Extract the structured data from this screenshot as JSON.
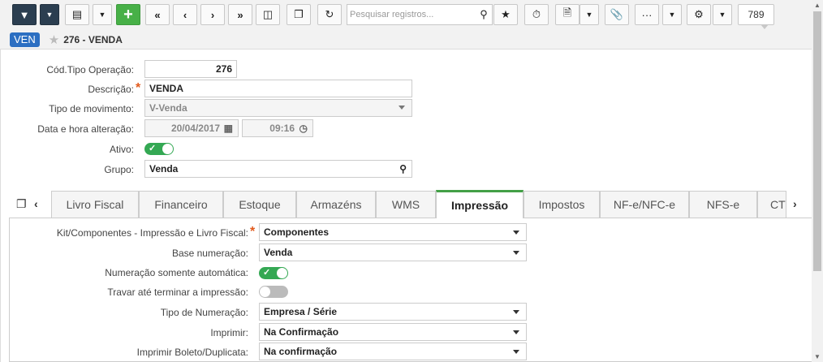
{
  "toolbar": {
    "search_placeholder": "Pesquisar registros...",
    "record_count": "789",
    "icons": [
      "filter-icon",
      "dropdown-icon",
      "grid-icon",
      "dropdown-icon",
      "add-icon",
      "first-icon",
      "prev-icon",
      "next-icon",
      "last-icon",
      "delete-icon",
      "copy-icon",
      "refresh-icon",
      "search-icon",
      "star-icon",
      "timer-icon",
      "export-icon",
      "dropdown-icon",
      "attach-icon",
      "more-icon",
      "dropdown-icon",
      "gear-icon",
      "dropdown-icon"
    ]
  },
  "header": {
    "badge": "VEN",
    "record_title": "276 - VENDA",
    "badge_color": "#2c6fc2"
  },
  "form": {
    "cod_label": "Cód.Tipo Operação:",
    "cod_value": "276",
    "desc_label": "Descrição:",
    "desc_value": "VENDA",
    "tipo_mov_label": "Tipo de movimento:",
    "tipo_mov_value": "V-Venda",
    "data_label": "Data e hora alteração:",
    "data_value": "20/04/2017",
    "hora_value": "09:16",
    "ativo_label": "Ativo:",
    "ativo": true,
    "grupo_label": "Grupo:",
    "grupo_value": "Venda"
  },
  "tabs": [
    {
      "label": "Livro Fiscal"
    },
    {
      "label": "Financeiro"
    },
    {
      "label": "Estoque"
    },
    {
      "label": "Armazéns"
    },
    {
      "label": "WMS"
    },
    {
      "label": "Impressão"
    },
    {
      "label": "Impostos"
    },
    {
      "label": "NF-e/NFC-e"
    },
    {
      "label": "NFS-e"
    },
    {
      "label": "CT"
    }
  ],
  "active_tab": "Impressão",
  "impressao": {
    "kit_label": "Kit/Componentes - Impressão e Livro Fiscal:",
    "kit_value": "Componentes",
    "base_label": "Base numeração:",
    "base_value": "Venda",
    "num_auto_label": "Numeração somente automática:",
    "num_auto": true,
    "travar_label": "Travar até terminar a impressão:",
    "travar": false,
    "tipo_num_label": "Tipo de Numeração:",
    "tipo_num_value": "Empresa / Série",
    "imprimir_label": "Imprimir:",
    "imprimir_value": "Na Confirmação",
    "boleto_label": "Imprimir Boleto/Duplicata:",
    "boleto_value": "Na confirmação"
  },
  "colors": {
    "accent_green": "#43a047",
    "toggle_on": "#34a853",
    "required": "#e25a1c",
    "toolbar_dark": "#2b3e50"
  }
}
